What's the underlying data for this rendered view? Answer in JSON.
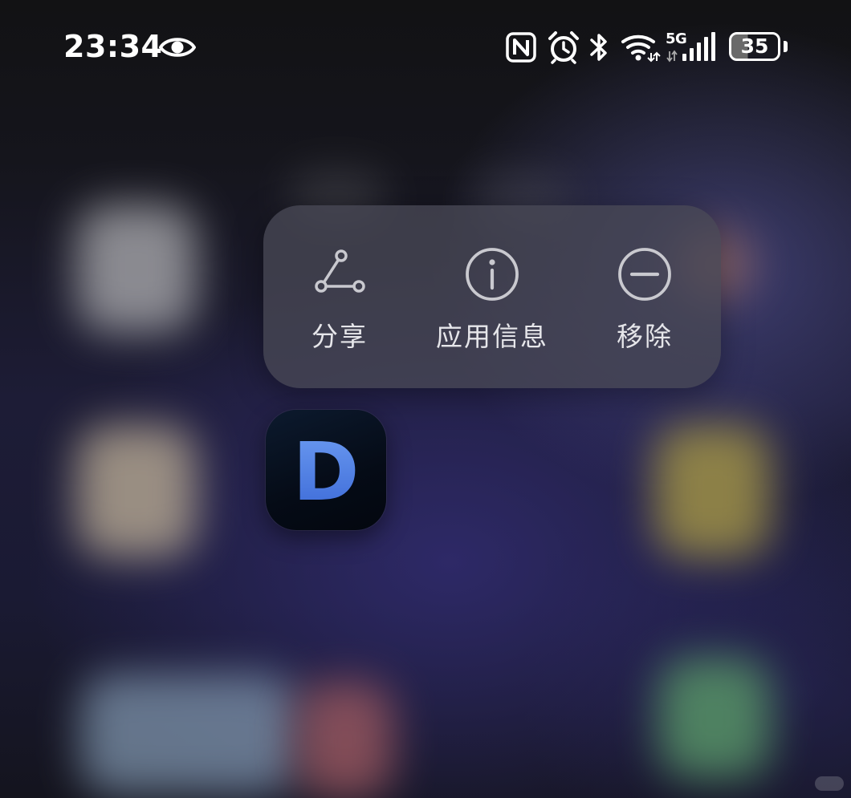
{
  "status_bar": {
    "time": "23:34",
    "network_type": "5G",
    "battery_level": "35",
    "icons": [
      "eye-icon",
      "nfc-icon",
      "alarm-icon",
      "bluetooth-icon",
      "wifi-icon",
      "signal-icon",
      "battery-icon"
    ]
  },
  "context_menu": {
    "items": [
      {
        "label": "分享",
        "icon": "share-icon"
      },
      {
        "label": "应用信息",
        "icon": "info-icon"
      },
      {
        "label": "移除",
        "icon": "remove-icon"
      }
    ]
  },
  "app": {
    "icon_letter": "D",
    "colors": {
      "icon_bg": "#050b16",
      "letter_top": "#6d9cf2",
      "letter_bottom": "#3a68d6"
    }
  },
  "colors": {
    "menu_bg": "#48485a",
    "menu_text": "#e6e6ea"
  }
}
